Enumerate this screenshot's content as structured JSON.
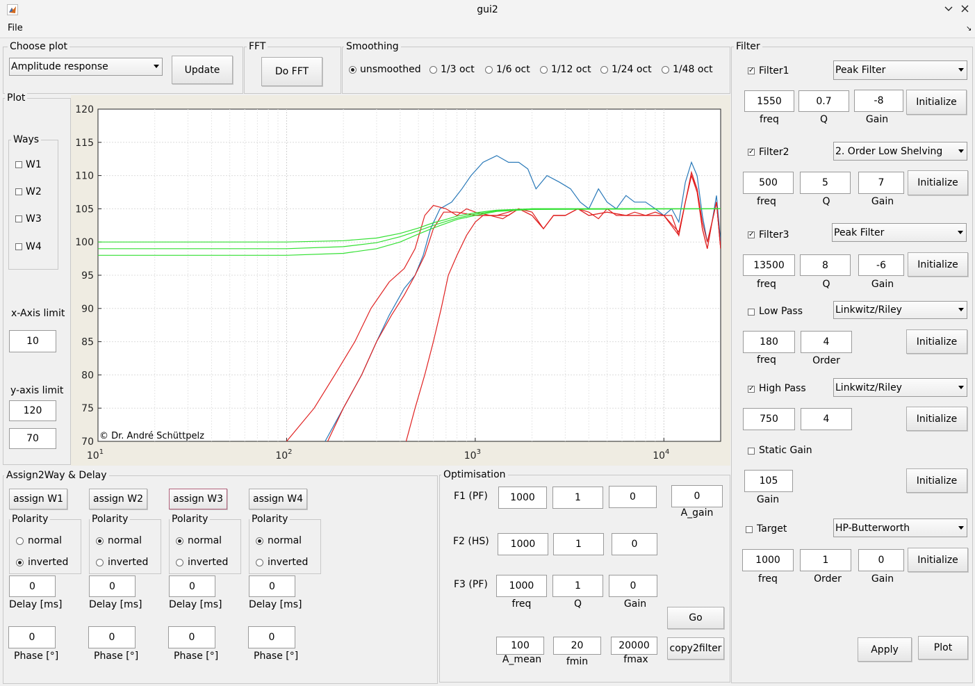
{
  "window": {
    "title": "gui2"
  },
  "menu": {
    "file": "File"
  },
  "choose_plot": {
    "label": "Choose plot",
    "selected": "Amplitude response",
    "update": "Update"
  },
  "fft": {
    "label": "FFT",
    "button": "Do FFT"
  },
  "smoothing": {
    "label": "Smoothing",
    "options": [
      "unsmoothed",
      "1/3 oct",
      "1/6 oct",
      "1/12 oct",
      "1/24 oct",
      "1/48 oct"
    ],
    "selected": "unsmoothed"
  },
  "plot_panel": {
    "label": "Plot",
    "ways_label": "Ways",
    "ways": [
      "W1",
      "W2",
      "W3",
      "W4"
    ],
    "x_limit_label": "x-Axis limit",
    "x_limit": "10",
    "y_limit_label": "y-axis limit",
    "y_limit_max": "120",
    "y_limit_min": "70"
  },
  "chart_data": {
    "type": "line",
    "x_scale": "log",
    "xlim": [
      10,
      20000
    ],
    "ylim": [
      70,
      120
    ],
    "grid": true,
    "y_ticks": [
      "120",
      "115",
      "110",
      "105",
      "100",
      "95",
      "90",
      "85",
      "80",
      "75",
      "70"
    ],
    "x_ticks": [
      {
        "base": "10",
        "exp": "1"
      },
      {
        "base": "10",
        "exp": "2"
      },
      {
        "base": "10",
        "exp": "3"
      },
      {
        "base": "10",
        "exp": "4"
      }
    ],
    "annotation": "© Dr. André Schüttpelz",
    "series": [
      {
        "color": "#2878b8",
        "points": [
          [
            160,
            70
          ],
          [
            200,
            75
          ],
          [
            250,
            80
          ],
          [
            300,
            85
          ],
          [
            350,
            89
          ],
          [
            420,
            93
          ],
          [
            480,
            95
          ],
          [
            530,
            98
          ],
          [
            580,
            102
          ],
          [
            650,
            105
          ],
          [
            750,
            106
          ],
          [
            850,
            108
          ],
          [
            950,
            110
          ],
          [
            1100,
            112
          ],
          [
            1300,
            113
          ],
          [
            1500,
            112
          ],
          [
            1700,
            112
          ],
          [
            1900,
            111
          ],
          [
            2100,
            108
          ],
          [
            2400,
            110
          ],
          [
            2800,
            109
          ],
          [
            3200,
            108
          ],
          [
            3600,
            106
          ],
          [
            4000,
            105
          ],
          [
            4500,
            108
          ],
          [
            5000,
            106
          ],
          [
            5600,
            105
          ],
          [
            6300,
            107
          ],
          [
            7000,
            106
          ],
          [
            8000,
            106
          ],
          [
            9000,
            105
          ],
          [
            10000,
            104
          ],
          [
            11000,
            105
          ],
          [
            12000,
            103
          ],
          [
            13000,
            109
          ],
          [
            14000,
            112
          ],
          [
            15000,
            110
          ],
          [
            16000,
            104
          ],
          [
            17000,
            100
          ],
          [
            18000,
            103
          ],
          [
            19000,
            107
          ],
          [
            20000,
            100
          ]
        ]
      },
      {
        "color": "#e02020",
        "points": [
          [
            100,
            70
          ],
          [
            140,
            75
          ],
          [
            180,
            80
          ],
          [
            230,
            85
          ],
          [
            280,
            90
          ],
          [
            350,
            94
          ],
          [
            420,
            96
          ],
          [
            480,
            99
          ],
          [
            540,
            104
          ],
          [
            600,
            105.5
          ],
          [
            700,
            105
          ],
          [
            800,
            104
          ],
          [
            900,
            105
          ],
          [
            1000,
            104.5
          ],
          [
            1200,
            104
          ],
          [
            1400,
            103.5
          ],
          [
            1700,
            105
          ],
          [
            2000,
            104.5
          ],
          [
            2300,
            102
          ],
          [
            2600,
            104
          ],
          [
            3000,
            104
          ],
          [
            3500,
            105
          ],
          [
            4000,
            104.5
          ],
          [
            4500,
            103.5
          ],
          [
            5000,
            105
          ],
          [
            5600,
            104
          ],
          [
            6300,
            104
          ],
          [
            7000,
            104.5
          ],
          [
            8000,
            104
          ],
          [
            9000,
            104.5
          ],
          [
            10000,
            104
          ],
          [
            11000,
            104
          ],
          [
            12000,
            101
          ],
          [
            13000,
            106
          ],
          [
            14000,
            110
          ],
          [
            15000,
            108
          ],
          [
            16000,
            103
          ],
          [
            17000,
            100
          ],
          [
            18000,
            103
          ],
          [
            19000,
            106
          ],
          [
            20000,
            99
          ]
        ]
      },
      {
        "color": "#e02020",
        "points": [
          [
            165,
            70
          ],
          [
            200,
            75
          ],
          [
            250,
            80
          ],
          [
            300,
            85
          ],
          [
            360,
            89
          ],
          [
            420,
            92
          ],
          [
            480,
            95
          ],
          [
            540,
            98
          ],
          [
            600,
            102
          ],
          [
            680,
            104.5
          ],
          [
            800,
            104.5
          ],
          [
            1000,
            104
          ],
          [
            1300,
            104
          ],
          [
            1500,
            104
          ],
          [
            1700,
            105
          ],
          [
            2000,
            104
          ],
          [
            2300,
            102
          ],
          [
            2600,
            104
          ],
          [
            3000,
            104
          ],
          [
            3500,
            105
          ],
          [
            4000,
            104
          ],
          [
            5000,
            104.5
          ],
          [
            6300,
            104
          ],
          [
            8000,
            104
          ],
          [
            10000,
            104
          ],
          [
            12000,
            101.5
          ],
          [
            13000,
            106
          ],
          [
            14000,
            110.5
          ],
          [
            15000,
            108
          ],
          [
            16000,
            102
          ],
          [
            17000,
            99
          ],
          [
            18000,
            103
          ],
          [
            19000,
            106
          ],
          [
            20000,
            99
          ]
        ]
      },
      {
        "color": "#e02020",
        "points": [
          [
            430,
            70
          ],
          [
            480,
            75
          ],
          [
            540,
            80
          ],
          [
            600,
            85
          ],
          [
            660,
            90
          ],
          [
            720,
            95
          ],
          [
            800,
            98
          ],
          [
            900,
            101
          ],
          [
            1000,
            103
          ],
          [
            1100,
            104
          ],
          [
            1300,
            104
          ],
          [
            1500,
            104.5
          ],
          [
            1700,
            105
          ],
          [
            2000,
            104
          ],
          [
            2300,
            102
          ],
          [
            2600,
            104
          ],
          [
            3000,
            104
          ],
          [
            3500,
            105
          ],
          [
            4000,
            104
          ],
          [
            5000,
            104.5
          ],
          [
            6300,
            104
          ],
          [
            8000,
            104
          ],
          [
            10000,
            104
          ],
          [
            12000,
            101
          ],
          [
            13000,
            106
          ],
          [
            14000,
            110
          ],
          [
            15000,
            107.5
          ],
          [
            16000,
            102
          ],
          [
            17000,
            99
          ],
          [
            18000,
            103
          ],
          [
            19000,
            106
          ],
          [
            20000,
            99
          ]
        ]
      },
      {
        "color": "#32e032",
        "points": [
          [
            10,
            100
          ],
          [
            100,
            100
          ],
          [
            200,
            100.2
          ],
          [
            300,
            100.6
          ],
          [
            400,
            101.3
          ],
          [
            500,
            102.1
          ],
          [
            600,
            102.9
          ],
          [
            700,
            103.4
          ],
          [
            800,
            103.9
          ],
          [
            1000,
            104.4
          ],
          [
            1300,
            104.8
          ],
          [
            2000,
            105
          ],
          [
            20000,
            105
          ]
        ]
      },
      {
        "color": "#32e032",
        "points": [
          [
            10,
            99
          ],
          [
            100,
            99
          ],
          [
            200,
            99.3
          ],
          [
            300,
            99.9
          ],
          [
            400,
            100.8
          ],
          [
            500,
            101.7
          ],
          [
            600,
            102.5
          ],
          [
            700,
            103.1
          ],
          [
            800,
            103.6
          ],
          [
            1000,
            104.2
          ],
          [
            1300,
            104.7
          ],
          [
            2000,
            105
          ],
          [
            20000,
            105
          ]
        ]
      },
      {
        "color": "#32e032",
        "points": [
          [
            10,
            98
          ],
          [
            100,
            98
          ],
          [
            200,
            98.3
          ],
          [
            300,
            99
          ],
          [
            400,
            100
          ],
          [
            500,
            101.2
          ],
          [
            600,
            102.1
          ],
          [
            700,
            102.8
          ],
          [
            800,
            103.4
          ],
          [
            1000,
            104
          ],
          [
            1300,
            104.6
          ],
          [
            2000,
            104.9
          ],
          [
            20000,
            105
          ]
        ]
      }
    ]
  },
  "assign": {
    "label": "Assign2Way & Delay",
    "polarity_label": "Polarity",
    "normal": "normal",
    "inverted": "inverted",
    "delay_label": "Delay [ms]",
    "phase_label": "Phase [°]",
    "ways": [
      {
        "button": "assign W1",
        "polarity": "inverted",
        "delay": "0",
        "phase": "0"
      },
      {
        "button": "assign W2",
        "polarity": "normal",
        "delay": "0",
        "phase": "0"
      },
      {
        "button": "assign W3",
        "polarity": "normal",
        "delay": "0",
        "phase": "0"
      },
      {
        "button": "assign W4",
        "polarity": "normal",
        "delay": "0",
        "phase": "0"
      }
    ]
  },
  "optimisation": {
    "label": "Optimisation",
    "f1_label": "F1 (PF)",
    "f1": [
      "1000",
      "1",
      "0"
    ],
    "f2_label": "F2 (HS)",
    "f2": [
      "1000",
      "1",
      "0"
    ],
    "f3_label": "F3 (PF)",
    "f3": [
      "1000",
      "1",
      "0"
    ],
    "col_freq": "freq",
    "col_q": "Q",
    "col_gain": "Gain",
    "a_gain": "0",
    "a_gain_label": "A_gain",
    "a_mean": "100",
    "a_mean_label": "A_mean",
    "fmin": "20",
    "fmin_label": "fmin",
    "fmax": "20000",
    "fmax_label": "fmax",
    "go": "Go",
    "copy2filter": "copy2filter"
  },
  "filter": {
    "label": "Filter",
    "initialize": "Initialize",
    "filter1": {
      "label": "Filter1",
      "checked": true,
      "type": "Peak Filter",
      "freq": "1550",
      "q": "0.7",
      "gain": "-8"
    },
    "filter2": {
      "label": "Filter2",
      "checked": true,
      "type": "2. Order Low Shelving",
      "freq": "500",
      "q": "5",
      "gain": "7"
    },
    "filter3": {
      "label": "Filter3",
      "checked": true,
      "type": "Peak Filter",
      "freq": "13500",
      "q": "8",
      "gain": "-6"
    },
    "lowpass": {
      "label": "Low Pass",
      "checked": false,
      "type": "Linkwitz/Riley",
      "freq": "180",
      "order": "4"
    },
    "highpass": {
      "label": "High Pass",
      "checked": true,
      "type": "Linkwitz/Riley",
      "freq": "750",
      "order": "4"
    },
    "static_gain": {
      "label": "Static Gain",
      "checked": false,
      "gain": "105"
    },
    "target": {
      "label": "Target",
      "checked": false,
      "type": "HP-Butterworth",
      "freq": "1000",
      "order": "1",
      "gain": "0"
    },
    "freq_label": "freq",
    "q_label": "Q",
    "gain_label": "Gain",
    "order_label": "Order",
    "apply": "Apply",
    "plot": "Plot"
  }
}
